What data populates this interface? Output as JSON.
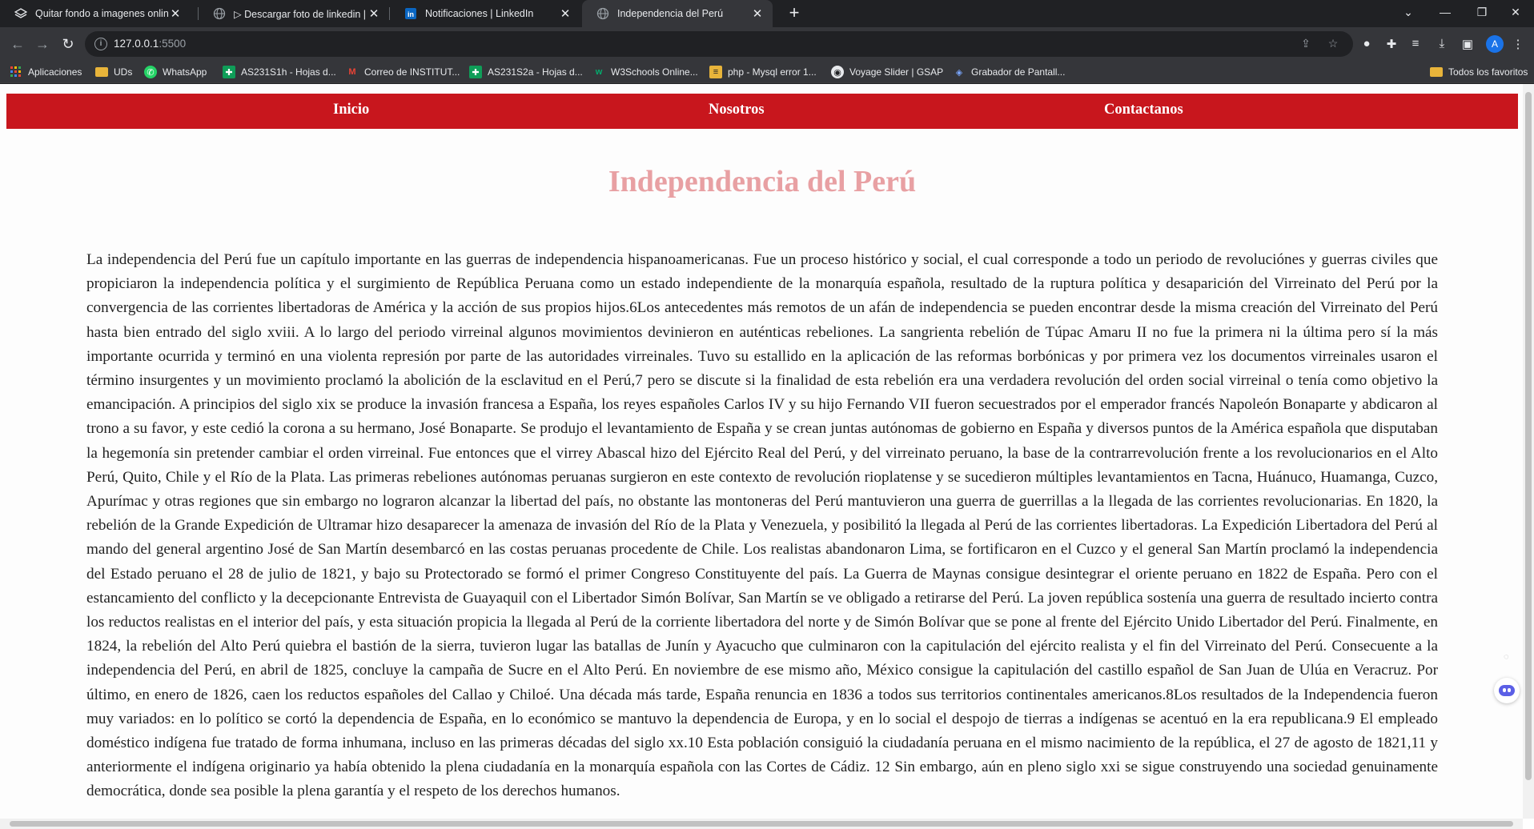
{
  "browser": {
    "tabs": [
      {
        "title": "Quitar fondo a imagenes online",
        "icon": "layers-icon",
        "active": false
      },
      {
        "title": "▷ Descargar foto de linkedin | A",
        "icon": "globe-icon",
        "active": false
      },
      {
        "title": "Notificaciones | LinkedIn",
        "icon": "linkedin-icon",
        "active": false
      },
      {
        "title": "Independencia del Perú",
        "icon": "globe-icon",
        "active": true
      }
    ],
    "new_tab_label": "+",
    "address": {
      "host": "127.0.0.1",
      "port": ":5500"
    },
    "avatar_letter": "A",
    "bookmarks": [
      {
        "label": "Aplicaciones",
        "icon": "apps-grid-icon"
      },
      {
        "label": "UDs",
        "icon": "folder-icon"
      },
      {
        "label": "WhatsApp",
        "icon": "whatsapp-icon"
      },
      {
        "label": "AS231S1h - Hojas d...",
        "icon": "sheets-icon"
      },
      {
        "label": "Correo de INSTITUT...",
        "icon": "gmail-icon"
      },
      {
        "label": "AS231S2a - Hojas d...",
        "icon": "sheets-icon"
      },
      {
        "label": "W3Schools Online...",
        "icon": "w3schools-icon"
      },
      {
        "label": "php - Mysql error 1...",
        "icon": "stackoverflow-icon"
      },
      {
        "label": "Voyage Slider | GSAP",
        "icon": "gsap-icon"
      },
      {
        "label": "Grabador de Pantall...",
        "icon": "recorder-icon"
      }
    ],
    "all_bookmarks_label": "Todos los favoritos"
  },
  "page": {
    "nav": {
      "inicio": "Inicio",
      "nosotros": "Nosotros",
      "contactanos": "Contactanos"
    },
    "title": "Independencia del Perú",
    "body": "La independencia del Perú fue un capítulo importante en las guerras de independencia hispanoamericanas. Fue un proceso histórico y social, el cual corresponde a todo un periodo de revoluciónes y guerras civiles que propiciaron la independencia política y el surgimiento de República Peruana como un estado independiente de la monarquía española, resultado de la ruptura política y desaparición del Virreinato del Perú por la convergencia de las corrientes libertadoras de América y la acción de sus propios hijos.6Los antecedentes más remotos de un afán de independencia se pueden encontrar desde la misma creación del Virreinato del Perú hasta bien entrado del siglo xviii. A lo largo del periodo virreinal algunos movimientos devinieron en auténticas rebeliones. La sangrienta rebelión de Túpac Amaru II no fue la primera ni la última pero sí la más importante ocurrida y terminó en una violenta represión por parte de las autoridades virreinales. Tuvo su estallido en la aplicación de las reformas borbónicas y por primera vez los documentos virreinales usaron el término insurgentes y un movimiento proclamó la abolición de la esclavitud en el Perú,7 pero se discute si la finalidad de esta rebelión era una verdadera revolución del orden social virreinal o tenía como objetivo la emancipación. A principios del siglo xix se produce la invasión francesa a España, los reyes españoles Carlos IV y su hijo Fernando VII fueron secuestrados por el emperador francés Napoleón Bonaparte y abdicaron al trono a su favor, y este cedió la corona a su hermano, José Bonaparte. Se produjo el levantamiento de España y se crean juntas autónomas de gobierno en España y diversos puntos de la América española que disputaban la hegemonía sin pretender cambiar el orden virreinal. Fue entonces que el virrey Abascal hizo del Ejército Real del Perú, y del virreinato peruano, la base de la contrarrevolución frente a los revolucionarios en el Alto Perú, Quito, Chile y el Río de la Plata. Las primeras rebeliones autónomas peruanas surgieron en este contexto de revolución rioplatense y se sucedieron múltiples levantamientos en Tacna, Huánuco, Huamanga, Cuzco, Apurímac y otras regiones que sin embargo no lograron alcanzar la libertad del país, no obstante las montoneras del Perú mantuvieron una guerra de guerrillas a la llegada de las corrientes revolucionarias. En 1820, la rebelión de la Grande Expedición de Ultramar hizo desaparecer la amenaza de invasión del Río de la Plata y Venezuela, y posibilitó la llegada al Perú de las corrientes libertadoras. La Expedición Libertadora del Perú al mando del general argentino José de San Martín desembarcó en las costas peruanas procedente de Chile. Los realistas abandonaron Lima, se fortificaron en el Cuzco y el general San Martín proclamó la independencia del Estado peruano el 28 de julio de 1821, y bajo su Protectorado se formó el primer Congreso Constituyente del país. La Guerra de Maynas consigue desintegrar el oriente peruano en 1822 de España. Pero con el estancamiento del conflicto y la decepcionante Entrevista de Guayaquil con el Libertador Simón Bolívar, San Martín se ve obligado a retirarse del Perú. La joven república sostenía una guerra de resultado incierto contra los reductos realistas en el interior del país, y esta situación propicia la llegada al Perú de la corriente libertadora del norte y de Simón Bolívar que se pone al frente del Ejército Unido Libertador del Perú. Finalmente, en 1824, la rebelión del Alto Perú quiebra el bastión de la sierra, tuvieron lugar las batallas de Junín y Ayacucho que culminaron con la capitulación del ejército realista y el fin del Virreinato del Perú. Consecuente a la independencia del Perú, en abril de 1825, concluye la campaña de Sucre en el Alto Perú. En noviembre de ese mismo año, México consigue la capitulación del castillo español de San Juan de Ulúa en Veracruz. Por último, en enero de 1826, caen los reductos españoles del Callao y Chiloé. Una década más tarde, España renuncia en 1836 a todos sus territorios continentales americanos.8Los resultados de la Independencia fueron muy variados: en lo político se cortó la dependencia de España, en lo económico se mantuvo la dependencia de Europa, y en lo social el despojo de tierras a indígenas se acentuó en la era republicana.9 El empleado doméstico indígena fue tratado de forma inhumana, incluso en las primeras décadas del siglo xx.10 Esta población consiguió la ciudadanía peruana en el mismo nacimiento de la república, el 27 de agosto de 1821,11 y anteriormente el indígena originario ya había obtenido la plena ciudadanía en la monarquía española con las Cortes de Cádiz. 12 Sin embargo, aún en pleno siglo xxi se sigue construyendo una sociedad genuinamente democrática, donde sea posible la plena garantía y el respeto de los derechos humanos."
  },
  "colors": {
    "nav_bg": "#c8161d",
    "title": "#e8a0a3",
    "browser_dark": "#202124",
    "browser_toolbar": "#35363a"
  }
}
